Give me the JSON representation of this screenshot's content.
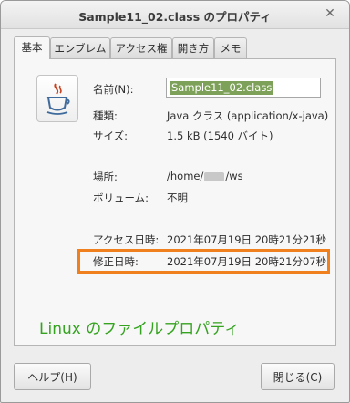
{
  "window": {
    "title": "Sample11_02.class のプロパティ",
    "close_glyph": "✕"
  },
  "tabs": [
    {
      "label": "基本"
    },
    {
      "label": "エンブレム"
    },
    {
      "label": "アクセス権"
    },
    {
      "label": "開き方"
    },
    {
      "label": "メモ"
    }
  ],
  "file_icon": {
    "name": "java-file-icon"
  },
  "properties": {
    "name_label": "名前(N):",
    "name_value": "Sample11_02.class",
    "type_label": "種類:",
    "type_value": "Java クラス (application/x-java)",
    "size_label": "サイズ:",
    "size_value": "1.5 kB (1540 バイト)",
    "location_label": "場所:",
    "location_prefix": "/home/",
    "location_suffix": "/ws",
    "volume_label": "ボリューム:",
    "volume_value": "不明",
    "accessed_label": "アクセス日時:",
    "accessed_value": "2021年07月19日 20時21分21秒",
    "modified_label": "修正日時:",
    "modified_value": "2021年07月19日 20時21分07秒"
  },
  "annotation": {
    "caption": "Linux のファイルプロパティ",
    "highlight_color": "#f07f1e",
    "caption_color": "#34a31f"
  },
  "buttons": {
    "help": "ヘルプ(H)",
    "close": "閉じる(C)"
  }
}
